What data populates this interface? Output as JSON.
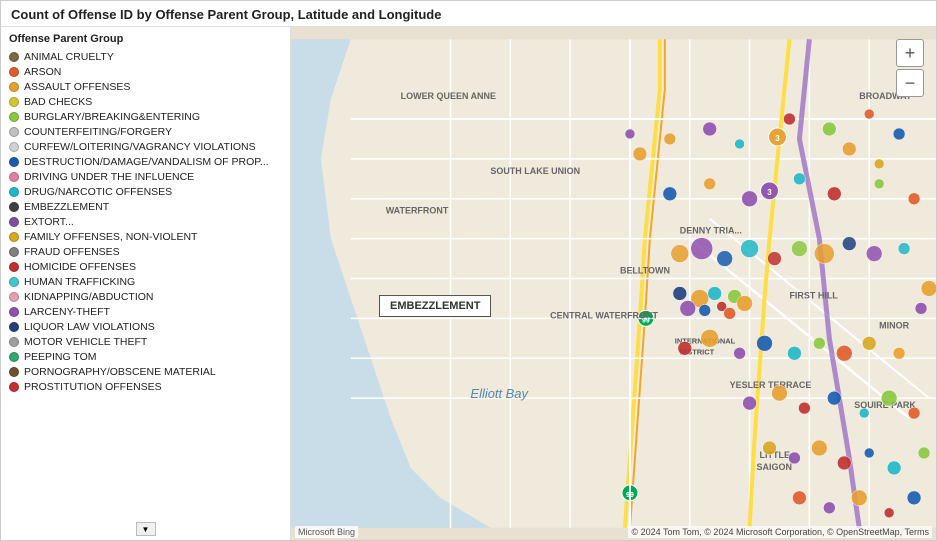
{
  "title": "Count of Offense ID by Offense Parent Group, Latitude and Longitude",
  "legend": {
    "header": "Offense Parent Group",
    "items": [
      {
        "label": "ANIMAL CRUELTY",
        "color": "#7B6C3E",
        "type": "dot"
      },
      {
        "label": "ARSON",
        "color": "#E05C2A",
        "type": "dot"
      },
      {
        "label": "ASSAULT OFFENSES",
        "color": "#E8A030",
        "type": "dot"
      },
      {
        "label": "BAD CHECKS",
        "color": "#D4C830",
        "type": "dot"
      },
      {
        "label": "BURGLARY/BREAKING&ENTERING",
        "color": "#8AC840",
        "type": "dot"
      },
      {
        "label": "COUNTERFEITING/FORGERY",
        "color": "#C0C0C0",
        "type": "dot"
      },
      {
        "label": "CURFEW/LOITERING/VAGRANCY VIOLATIONS",
        "color": "#D0D0D0",
        "type": "dot"
      },
      {
        "label": "DESTRUCTION/DAMAGE/VANDALISM OF PROP...",
        "color": "#1A5CB0",
        "type": "dot"
      },
      {
        "label": "DRIVING UNDER THE INFLUENCE",
        "color": "#E080A0",
        "type": "dot"
      },
      {
        "label": "DRUG/NARCOTIC OFFENSES",
        "color": "#20B8C8",
        "type": "dot"
      },
      {
        "label": "EMBEZZLEMENT",
        "color": "#404040",
        "type": "dot"
      },
      {
        "label": "EXTORT...",
        "color": "#8050A0",
        "type": "dot"
      },
      {
        "label": "FAMILY OFFENSES, NON-VIOLENT",
        "color": "#D8A820",
        "type": "dot"
      },
      {
        "label": "FRAUD OFFENSES",
        "color": "#808080",
        "type": "dot"
      },
      {
        "label": "HOMICIDE OFFENSES",
        "color": "#C03030",
        "type": "dot"
      },
      {
        "label": "HUMAN TRAFFICKING",
        "color": "#40C8D0",
        "type": "dot"
      },
      {
        "label": "KIDNAPPING/ABDUCTION",
        "color": "#E8A0B0",
        "type": "dot"
      },
      {
        "label": "LARCENY-THEFT",
        "color": "#9050B0",
        "type": "dot"
      },
      {
        "label": "LIQUOR LAW VIOLATIONS",
        "color": "#204080",
        "type": "dot"
      },
      {
        "label": "MOTOR VEHICLE THEFT",
        "color": "#A0A0A0",
        "type": "dot"
      },
      {
        "label": "PEEPING TOM",
        "color": "#30A870",
        "type": "dot"
      },
      {
        "label": "PORNOGRAPHY/OBSCENE MATERIAL",
        "color": "#705030",
        "type": "dot"
      },
      {
        "label": "PROSTITUTION OFFENSES",
        "color": "#C83030",
        "type": "dot"
      }
    ]
  },
  "tooltip": {
    "text": "EMBEZZLEMENT",
    "visible": true
  },
  "map": {
    "attribution": "© 2024 Tom Tom, © 2024 Microsoft Corporation, © OpenStreetMap, Terms",
    "bing_logo": "Microsoft Bing",
    "labels": [
      "LOWER QUEEN ANNE",
      "WATERFRONT",
      "DENNY TRIA...",
      "BELLTOWN",
      "CENTRAL WATERFRONT",
      "FIRST HILL",
      "YESLER TERRACE",
      "LITTLE SAIGON",
      "Elliott Bay",
      "BROADWAY",
      "MINOR",
      "SQUIRE PARK"
    ]
  },
  "zoom": {
    "in_label": "+",
    "out_label": "−"
  },
  "scroll_button_label": "▼"
}
